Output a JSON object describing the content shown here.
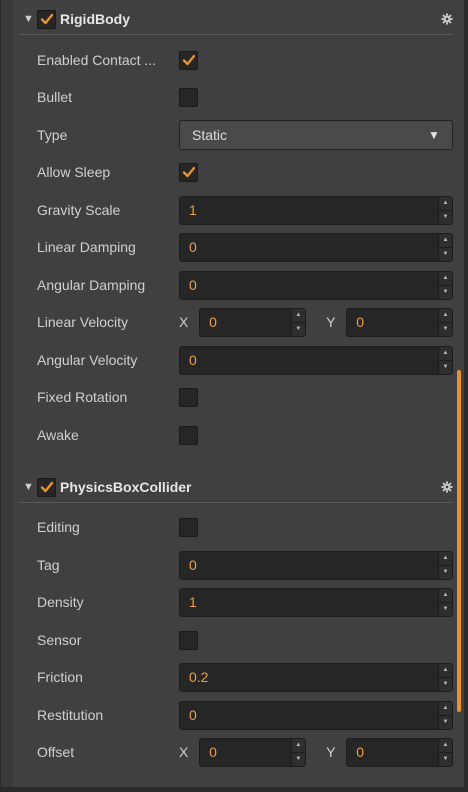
{
  "colors": {
    "accent": "#e8922f",
    "value_text": "#f0a040",
    "panel_bg": "#404040",
    "input_bg": "#262626"
  },
  "rigidbody": {
    "title": "RigidBody",
    "enabled": true,
    "collapse_icon": "triangle-down-icon",
    "settings_icon": "gear-icon",
    "rows": {
      "enabled_contact": {
        "label": "Enabled Contact ...",
        "checked": true
      },
      "bullet": {
        "label": "Bullet",
        "checked": false
      },
      "type": {
        "label": "Type",
        "value": "Static"
      },
      "allow_sleep": {
        "label": "Allow Sleep",
        "checked": true
      },
      "gravity_scale": {
        "label": "Gravity Scale",
        "value": "1"
      },
      "linear_damping": {
        "label": "Linear Damping",
        "value": "0"
      },
      "angular_damping": {
        "label": "Angular Damping",
        "value": "0"
      },
      "linear_velocity": {
        "label": "Linear Velocity",
        "x_label": "X",
        "x": "0",
        "y_label": "Y",
        "y": "0"
      },
      "angular_velocity": {
        "label": "Angular Velocity",
        "value": "0"
      },
      "fixed_rotation": {
        "label": "Fixed Rotation",
        "checked": false
      },
      "awake": {
        "label": "Awake",
        "checked": false
      }
    }
  },
  "collider": {
    "title": "PhysicsBoxCollider",
    "enabled": true,
    "collapse_icon": "triangle-down-icon",
    "settings_icon": "gear-icon",
    "rows": {
      "editing": {
        "label": "Editing",
        "checked": false
      },
      "tag": {
        "label": "Tag",
        "value": "0"
      },
      "density": {
        "label": "Density",
        "value": "1"
      },
      "sensor": {
        "label": "Sensor",
        "checked": false
      },
      "friction": {
        "label": "Friction",
        "value": "0.2"
      },
      "restitution": {
        "label": "Restitution",
        "value": "0"
      },
      "offset": {
        "label": "Offset",
        "x_label": "X",
        "x": "0",
        "y_label": "Y",
        "y": "0"
      }
    }
  }
}
